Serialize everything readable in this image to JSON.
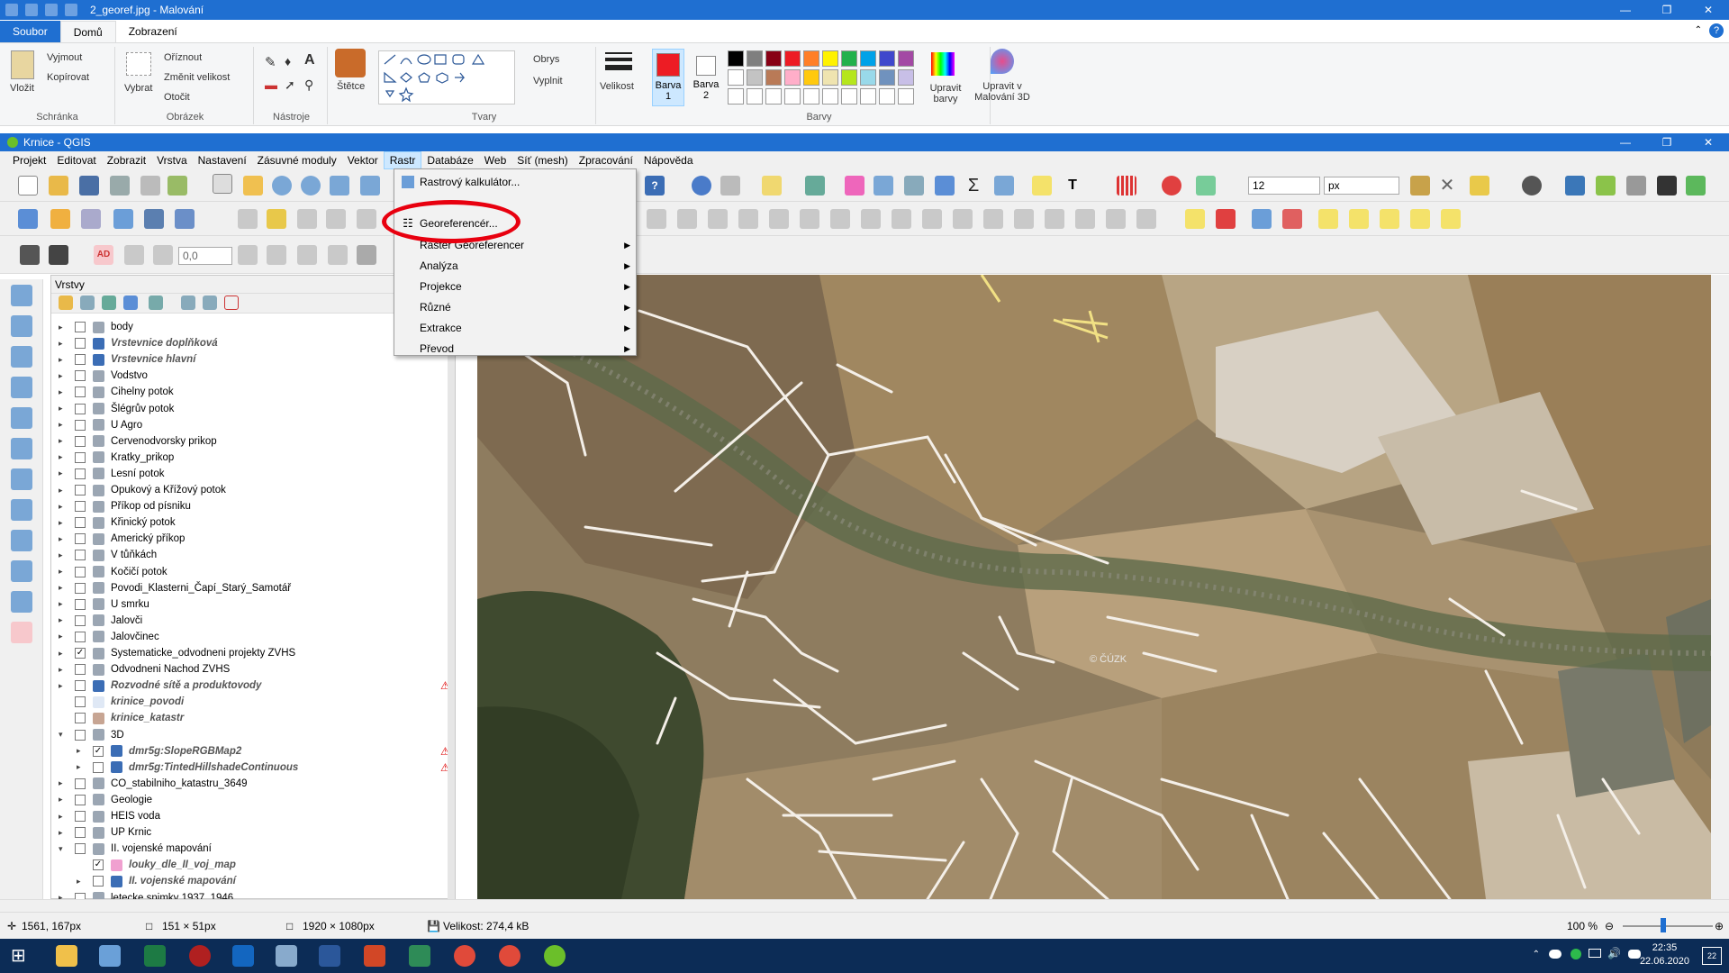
{
  "paint": {
    "window_title": "2_georef.jpg - Malování",
    "tabs": [
      "Soubor",
      "Domů",
      "Zobrazení"
    ],
    "clipboard": {
      "paste": "Vložit",
      "cut": "Vyjmout",
      "copy": "Kopírovat",
      "group": "Schránka"
    },
    "image": {
      "select": "Vybrat",
      "crop": "Oříznout",
      "resize": "Změnit velikost",
      "rotate": "Otočit",
      "group": "Obrázek"
    },
    "tools": {
      "group": "Nástroje"
    },
    "brushes": {
      "label": "Štětce"
    },
    "shapes": {
      "outline": "Obrys",
      "fill": "Vyplnit",
      "group": "Tvary"
    },
    "size": {
      "label": "Velikost"
    },
    "color1": {
      "label": "Barva",
      "num": "1"
    },
    "color2": {
      "label": "Barva",
      "num": "2"
    },
    "colors": {
      "group": "Barvy",
      "edit": "Upravit barvy",
      "edit3d": "Upravit v Malování 3D"
    },
    "palette": [
      "#000000",
      "#7f7f7f",
      "#880015",
      "#ed1c24",
      "#ff7f27",
      "#fff200",
      "#22b14c",
      "#00a2e8",
      "#3f48cc",
      "#a349a4",
      "#ffffff",
      "#c3c3c3",
      "#b97a57",
      "#ffaec9",
      "#ffc90e",
      "#efe4b0",
      "#b5e61d",
      "#99d9ea",
      "#7092be",
      "#c8bfe7"
    ]
  },
  "qgis": {
    "window_title": "Krnice - QGIS",
    "menu": [
      "Projekt",
      "Editovat",
      "Zobrazit",
      "Vrstva",
      "Nastavení",
      "Zásuvné moduly",
      "Vektor",
      "Rastr",
      "Databáze",
      "Web",
      "Síť (mesh)",
      "Zpracování",
      "Nápověda"
    ],
    "toolbar": {
      "size_value": "12",
      "unit": "px",
      "offset_value": "0,0"
    },
    "raster_menu": [
      {
        "label": "Rastrový kalkulátor...",
        "sub": false
      },
      {
        "label": "Georeferencér...",
        "sub": false
      },
      {
        "label": "Raster Georeferencer",
        "sub": true
      },
      {
        "label": "Analýza",
        "sub": true
      },
      {
        "label": "Projekce",
        "sub": true
      },
      {
        "label": "Různé",
        "sub": true
      },
      {
        "label": "Extrakce",
        "sub": true
      },
      {
        "label": "Převod",
        "sub": true
      }
    ],
    "layers_title": "Vrstvy",
    "layers": [
      {
        "name": "body",
        "style": "normal",
        "indent": 0,
        "arrow": "▸",
        "checked": false,
        "warn": false,
        "icon": "group"
      },
      {
        "name": "Vrstevnice doplňková",
        "style": "italic",
        "indent": 0,
        "arrow": "▸",
        "checked": false,
        "warn": false,
        "icon": "raster"
      },
      {
        "name": "Vrstevnice hlavní",
        "style": "italic",
        "indent": 0,
        "arrow": "▸",
        "checked": false,
        "warn": false,
        "icon": "raster"
      },
      {
        "name": "Vodstvo",
        "style": "normal",
        "indent": 0,
        "arrow": "▸",
        "checked": false,
        "warn": false,
        "icon": "group"
      },
      {
        "name": "Cihelny potok",
        "style": "normal",
        "indent": 0,
        "arrow": "▸",
        "checked": false,
        "warn": false,
        "icon": "group"
      },
      {
        "name": "Šlégrův potok",
        "style": "normal",
        "indent": 0,
        "arrow": "▸",
        "checked": false,
        "warn": false,
        "icon": "group"
      },
      {
        "name": "U Agro",
        "style": "normal",
        "indent": 0,
        "arrow": "▸",
        "checked": false,
        "warn": false,
        "icon": "group"
      },
      {
        "name": "Cervenodvorsky prikop",
        "style": "normal",
        "indent": 0,
        "arrow": "▸",
        "checked": false,
        "warn": false,
        "icon": "group"
      },
      {
        "name": "Kratky_prikop",
        "style": "normal",
        "indent": 0,
        "arrow": "▸",
        "checked": false,
        "warn": false,
        "icon": "group"
      },
      {
        "name": "Lesní potok",
        "style": "normal",
        "indent": 0,
        "arrow": "▸",
        "checked": false,
        "warn": false,
        "icon": "group"
      },
      {
        "name": "Opukový a Křížový potok",
        "style": "normal",
        "indent": 0,
        "arrow": "▸",
        "checked": false,
        "warn": false,
        "icon": "group"
      },
      {
        "name": "Příkop od písniku",
        "style": "normal",
        "indent": 0,
        "arrow": "▸",
        "checked": false,
        "warn": false,
        "icon": "group"
      },
      {
        "name": "Křinický potok",
        "style": "normal",
        "indent": 0,
        "arrow": "▸",
        "checked": false,
        "warn": false,
        "icon": "group"
      },
      {
        "name": "Americký příkop",
        "style": "normal",
        "indent": 0,
        "arrow": "▸",
        "checked": false,
        "warn": false,
        "icon": "group"
      },
      {
        "name": "V tůňkách",
        "style": "normal",
        "indent": 0,
        "arrow": "▸",
        "checked": false,
        "warn": false,
        "icon": "group"
      },
      {
        "name": "Kočičí potok",
        "style": "normal",
        "indent": 0,
        "arrow": "▸",
        "checked": false,
        "warn": false,
        "icon": "group"
      },
      {
        "name": "Povodi_Klasterni_Čapí_Starý_Samotář",
        "style": "normal",
        "indent": 0,
        "arrow": "▸",
        "checked": false,
        "warn": false,
        "icon": "group"
      },
      {
        "name": "U smrku",
        "style": "normal",
        "indent": 0,
        "arrow": "▸",
        "checked": false,
        "warn": false,
        "icon": "group"
      },
      {
        "name": "Jalovči",
        "style": "normal",
        "indent": 0,
        "arrow": "▸",
        "checked": false,
        "warn": false,
        "icon": "group"
      },
      {
        "name": "Jalovčinec",
        "style": "normal",
        "indent": 0,
        "arrow": "▸",
        "checked": false,
        "warn": false,
        "icon": "group"
      },
      {
        "name": "Systematicke_odvodneni projekty ZVHS",
        "style": "normal",
        "indent": 0,
        "arrow": "▸",
        "checked": true,
        "warn": false,
        "icon": "group"
      },
      {
        "name": "Odvodneni Nachod ZVHS",
        "style": "normal",
        "indent": 0,
        "arrow": "▸",
        "checked": false,
        "warn": false,
        "icon": "group"
      },
      {
        "name": "Rozvodné sítě a produktovody",
        "style": "italic",
        "indent": 0,
        "arrow": "▸",
        "checked": false,
        "warn": true,
        "icon": "raster"
      },
      {
        "name": "krinice_povodi",
        "style": "italic",
        "indent": 0,
        "arrow": "",
        "checked": false,
        "warn": false,
        "icon": "poly-light"
      },
      {
        "name": "krinice_katastr",
        "style": "italic",
        "indent": 0,
        "arrow": "",
        "checked": false,
        "warn": false,
        "icon": "poly-brown"
      },
      {
        "name": "3D",
        "style": "normal",
        "indent": 0,
        "arrow": "▾",
        "checked": false,
        "warn": false,
        "icon": "group"
      },
      {
        "name": "dmr5g:SlopeRGBMap2",
        "style": "italic",
        "indent": 1,
        "arrow": "▸",
        "checked": true,
        "warn": true,
        "icon": "raster"
      },
      {
        "name": "dmr5g:TintedHillshadeContinuous",
        "style": "italic",
        "indent": 1,
        "arrow": "▸",
        "checked": false,
        "warn": true,
        "icon": "raster"
      },
      {
        "name": "CO_stabilniho_katastru_3649",
        "style": "normal",
        "indent": 0,
        "arrow": "▸",
        "checked": false,
        "warn": false,
        "icon": "group"
      },
      {
        "name": "Geologie",
        "style": "normal",
        "indent": 0,
        "arrow": "▸",
        "checked": false,
        "warn": false,
        "icon": "group"
      },
      {
        "name": "HEIS voda",
        "style": "normal",
        "indent": 0,
        "arrow": "▸",
        "checked": false,
        "warn": false,
        "icon": "group"
      },
      {
        "name": "UP Krnic",
        "style": "normal",
        "indent": 0,
        "arrow": "▸",
        "checked": false,
        "warn": false,
        "icon": "group"
      },
      {
        "name": "II. vojenské mapování",
        "style": "normal",
        "indent": 0,
        "arrow": "▾",
        "checked": false,
        "warn": false,
        "icon": "group"
      },
      {
        "name": "louky_dle_II_voj_map",
        "style": "italic",
        "indent": 1,
        "arrow": "",
        "checked": true,
        "warn": false,
        "icon": "poly-pink"
      },
      {
        "name": "II. vojenské mapování",
        "style": "italic",
        "indent": 1,
        "arrow": "▸",
        "checked": false,
        "warn": false,
        "icon": "raster"
      },
      {
        "name": "letecke snimky 1937_1946",
        "style": "normal",
        "indent": 0,
        "arrow": "▸",
        "checked": false,
        "warn": false,
        "icon": "group"
      }
    ]
  },
  "map": {
    "watermark": "© ČÚZK"
  },
  "status": {
    "coords": "1561, 167px",
    "selection": "151 × 51px",
    "image_size": "1920 × 1080px",
    "file_size": "Velikost: 274,4 kB",
    "zoom": "100 %"
  },
  "taskbar": {
    "time": "22:35",
    "date": "22.06.2020",
    "notification_count": "22"
  }
}
